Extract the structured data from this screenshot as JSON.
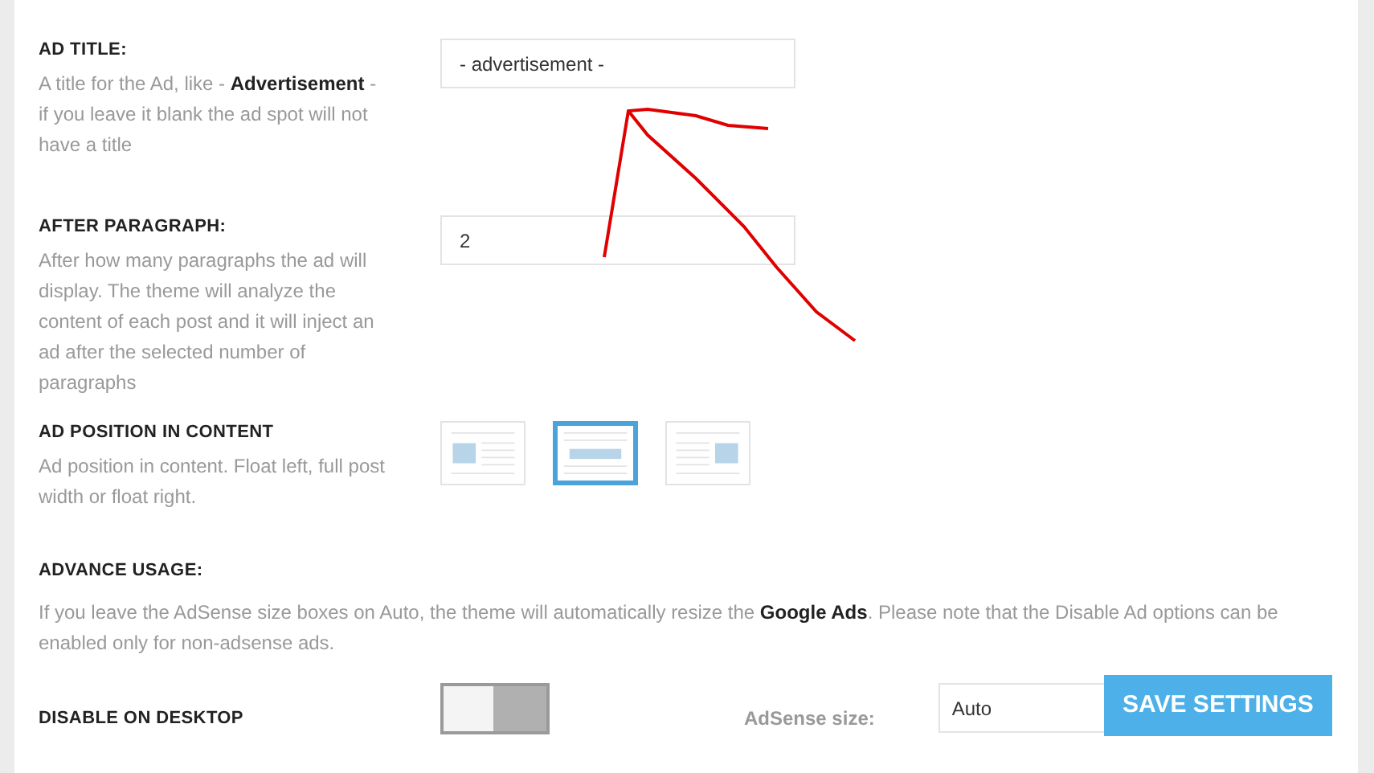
{
  "ad_title": {
    "label": "AD TITLE:",
    "description": "A title for the Ad, like - **Advertisement** - if you leave it blank the ad spot will not have a title",
    "value": "- advertisement -"
  },
  "after_paragraph": {
    "label": "AFTER PARAGRAPH:",
    "description": "After how many paragraphs the ad will display. The theme will analyze the content of each post and it will inject an ad after the selected number of paragraphs",
    "value": "2"
  },
  "ad_position": {
    "label": "AD POSITION IN CONTENT",
    "description": "Ad position in content. Float left, full post width or float right.",
    "options": [
      {
        "kind": "left",
        "selected": false
      },
      {
        "kind": "full",
        "selected": true
      },
      {
        "kind": "right",
        "selected": false
      }
    ]
  },
  "advance_usage": {
    "label": "ADVANCE USAGE:",
    "description": "If you leave the AdSense size boxes on Auto, the theme will automatically resize the **Google Ads**. Please note that the Disable Ad options can be enabled only for non-adsense ads."
  },
  "disable_on_desktop": {
    "label": "DISABLE ON DESKTOP",
    "on": false
  },
  "adsense_size": {
    "label": "AdSense size:",
    "value": "Auto"
  },
  "save_button": "SAVE SETTINGS"
}
